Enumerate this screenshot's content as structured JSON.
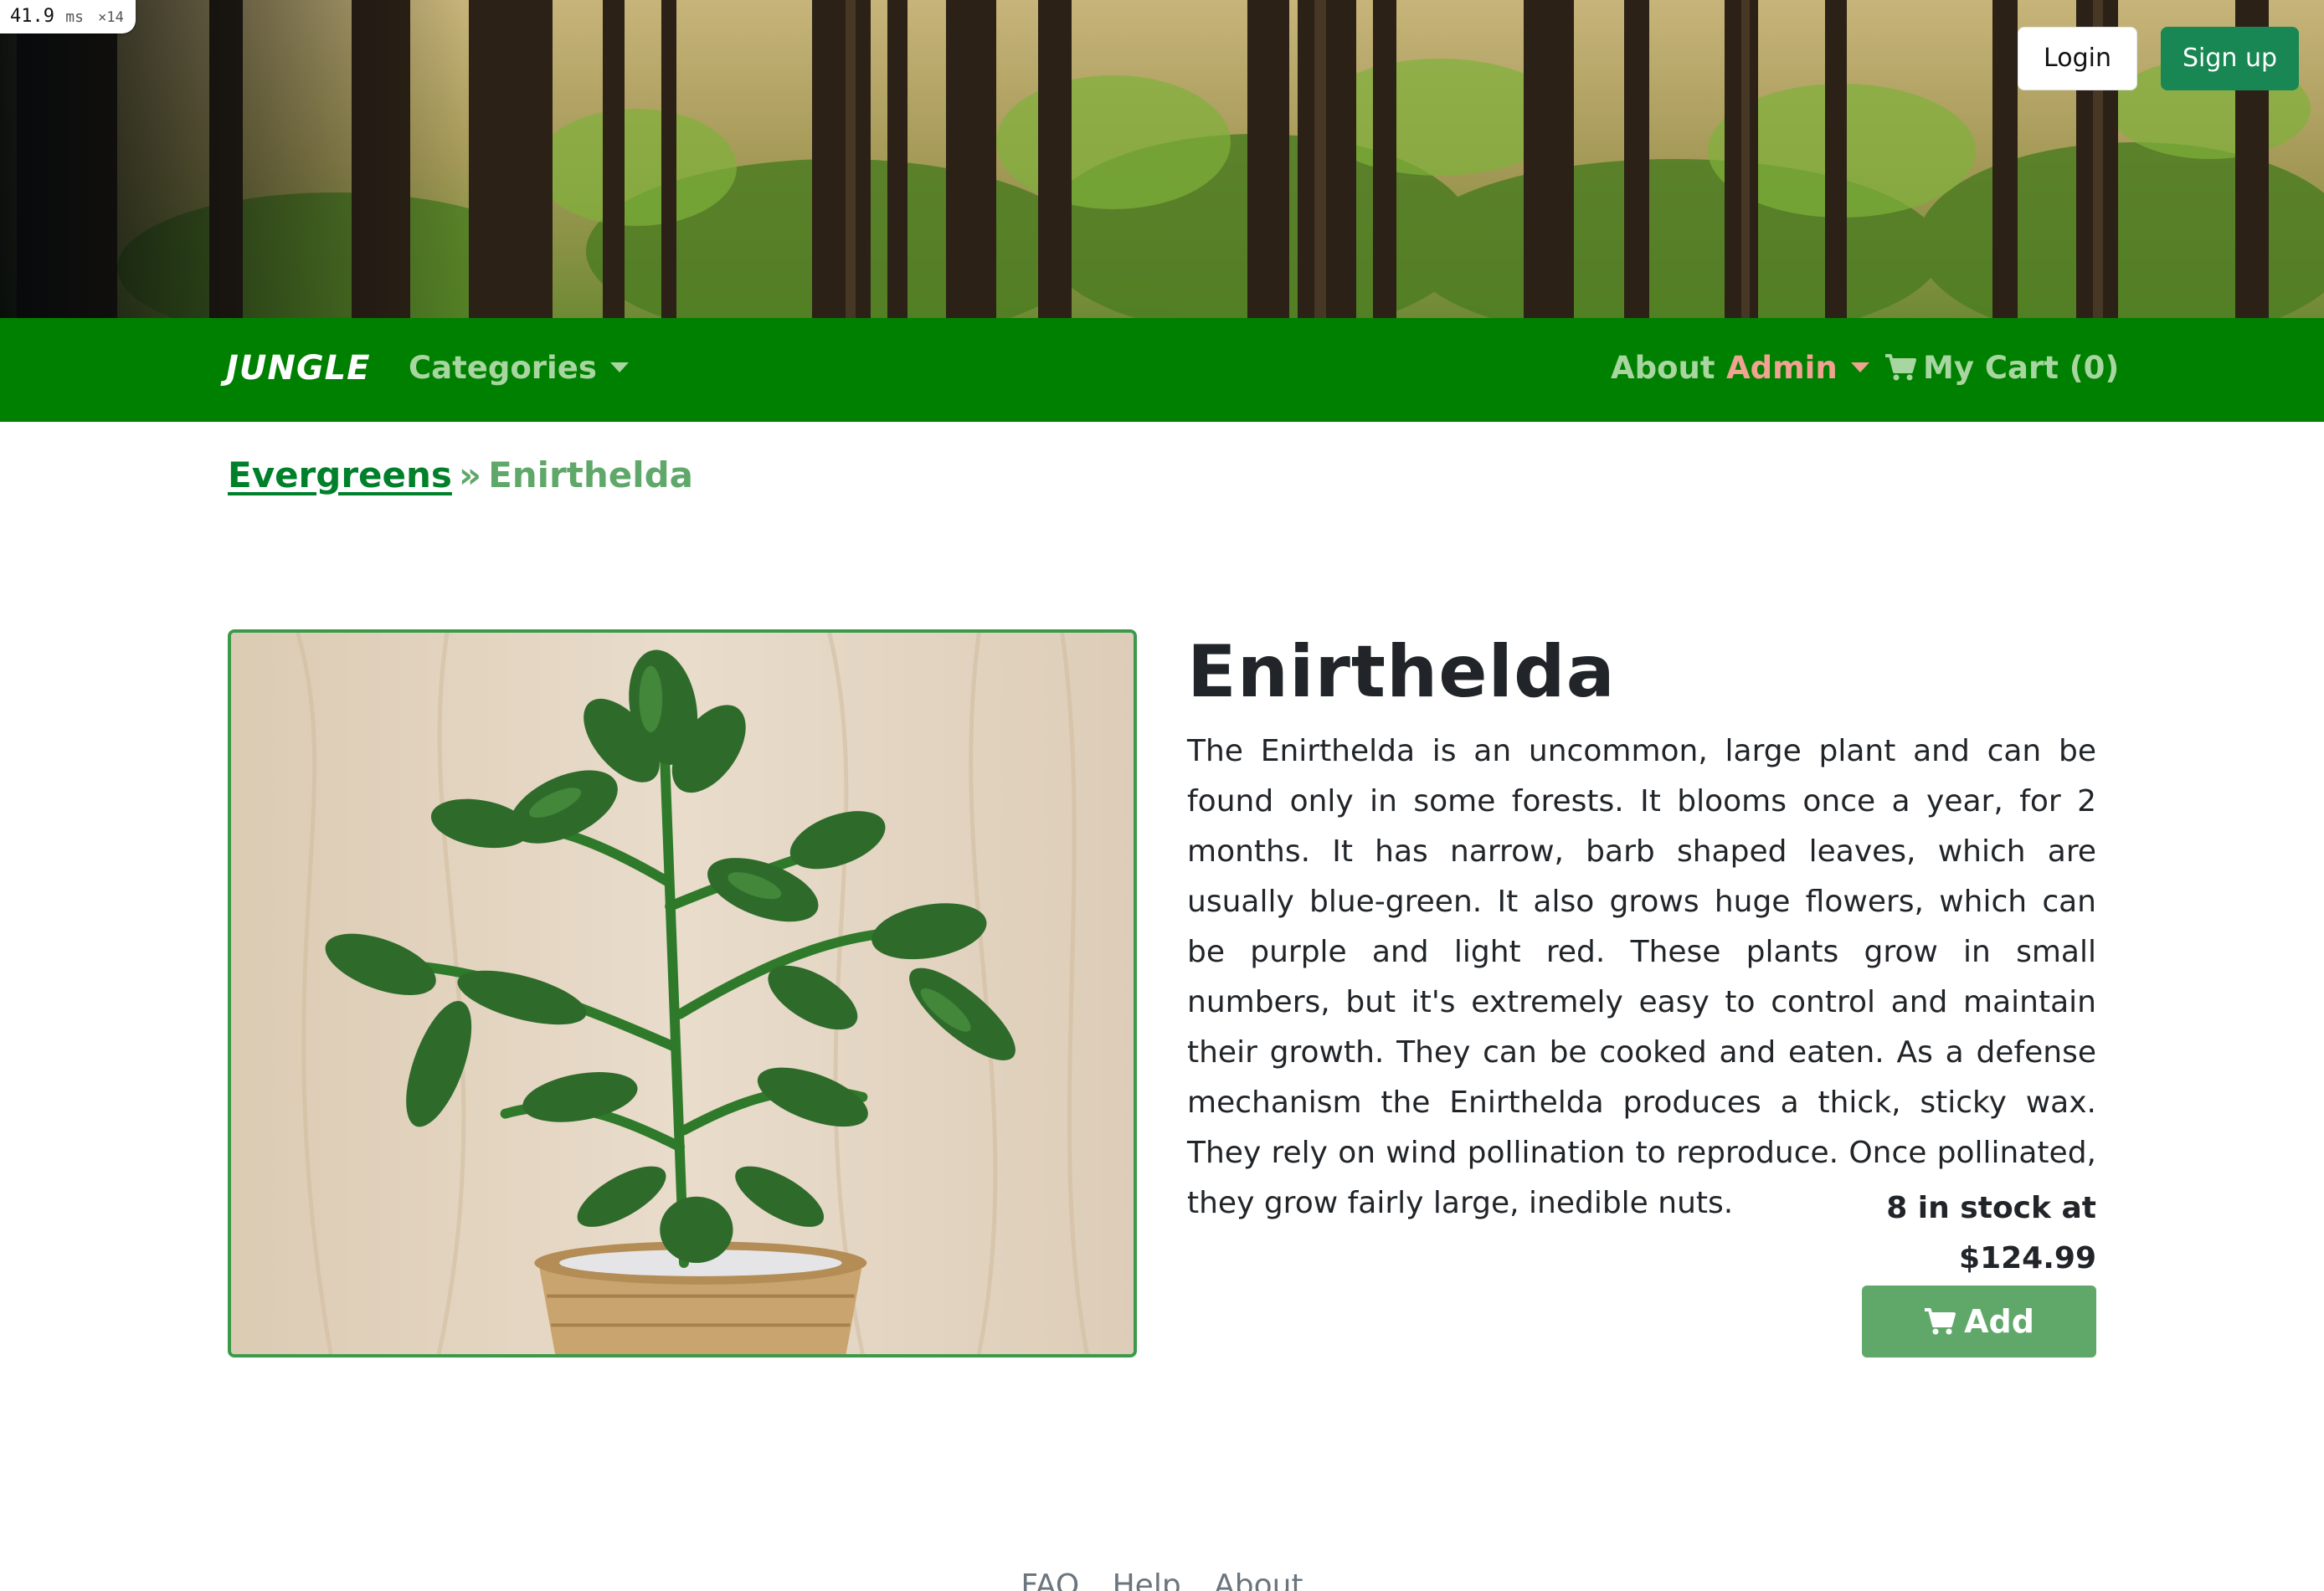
{
  "perf_overlay": {
    "value": "41.9",
    "unit": "ms",
    "multiplier": "×14"
  },
  "header": {
    "login_label": "Login",
    "signup_label": "Sign up"
  },
  "nav": {
    "brand": "JUNGLE",
    "categories_label": "Categories",
    "about_label": "About",
    "admin_label": "Admin",
    "cart_label": "My Cart (0)",
    "colors": {
      "bar": "#008000",
      "link": "#a8d6a0",
      "admin": "#f0a390"
    }
  },
  "breadcrumb": {
    "category": "Evergreens",
    "separator": "»",
    "current": "Enirthelda"
  },
  "product": {
    "name": "Enirthelda",
    "description": "The Enirthelda is an uncommon, large plant and can be found only in some forests. It blooms once a year, for 2 months. It has narrow, barb shaped leaves, which are usually blue-green. It also grows huge flowers, which can be purple and light red. These plants grow in small numbers, but it's extremely easy to control and maintain their growth. They can be cooked and eaten. As a defense mechanism the Enirthelda produces a thick, sticky wax. They rely on wind pollination to reproduce. Once pollinated, they grow fairly large, inedible nuts.",
    "stock_text": "8 in stock at",
    "price": "$124.99",
    "add_label": "Add",
    "image_icon": "potted-plant-photo"
  },
  "footer": {
    "links": [
      "FAQ",
      "Help",
      "About"
    ]
  }
}
